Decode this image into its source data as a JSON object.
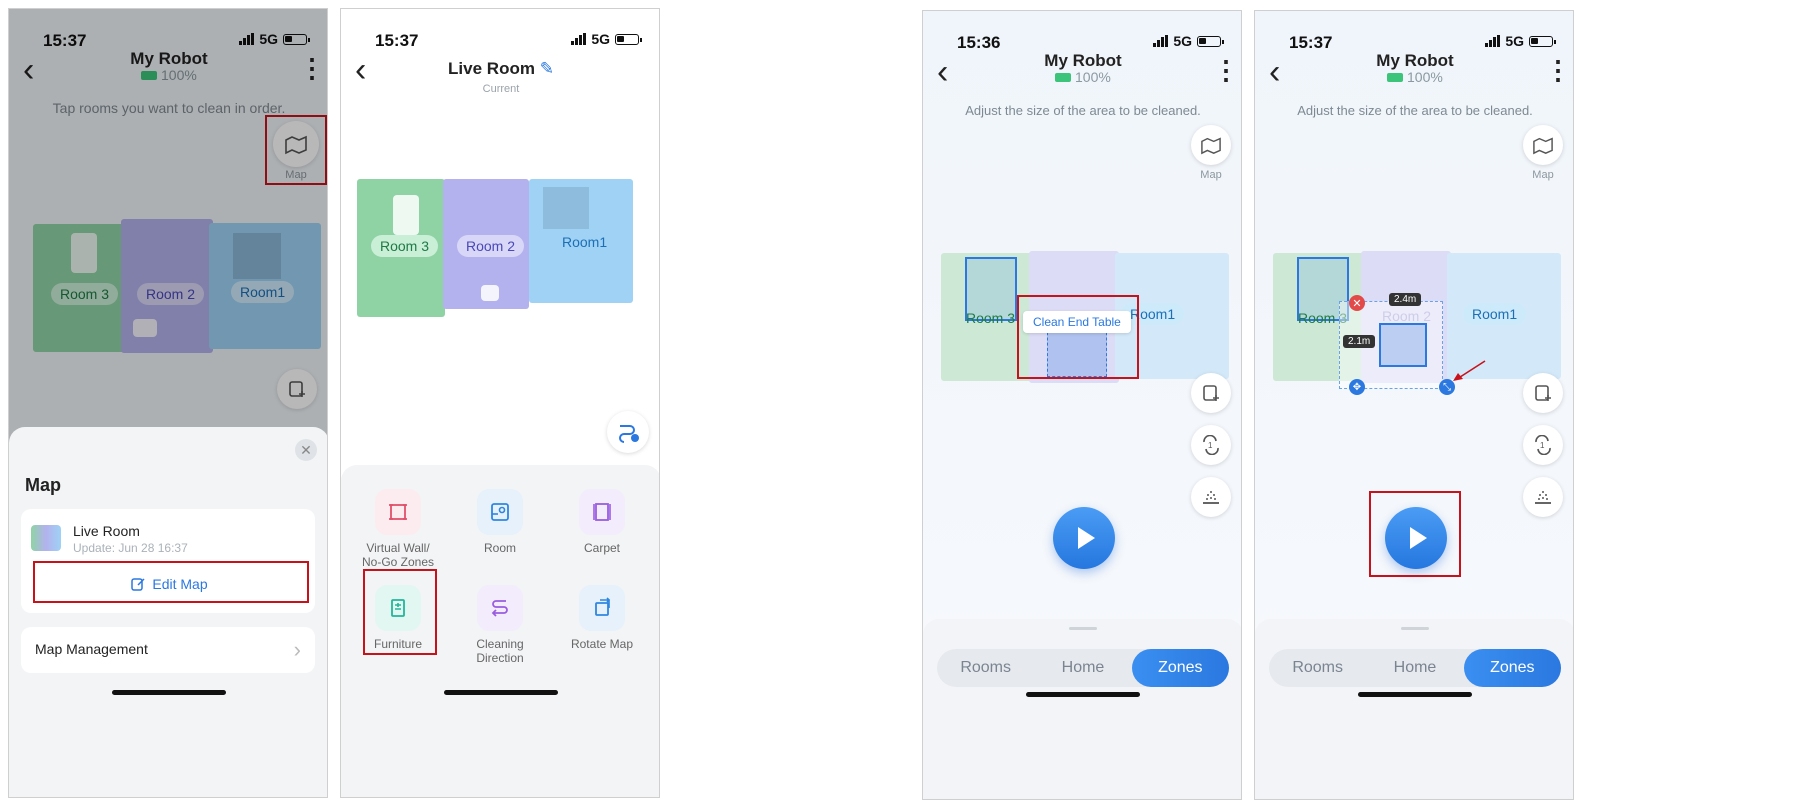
{
  "screen1": {
    "time": "15:37",
    "network": "5G",
    "title": "My Robot",
    "battery": "100%",
    "hint": "Tap rooms you want to clean in order.",
    "map_btn_label": "Map",
    "rooms": [
      "Room 3",
      "Room 2",
      "Room1"
    ],
    "sheet": {
      "title": "Map",
      "map_name": "Live Room",
      "map_update": "Update: Jun 28 16:37",
      "edit_label": "Edit Map",
      "management_label": "Map Management"
    }
  },
  "screen2": {
    "time": "15:37",
    "network": "5G",
    "title": "Live Room",
    "subtitle": "Current",
    "rooms": [
      "Room 3",
      "Room 2",
      "Room1"
    ],
    "tools": [
      {
        "label": "Virtual Wall/\nNo-Go Zones",
        "icon": "virtual-wall-icon",
        "color": "#e0506a"
      },
      {
        "label": "Room",
        "icon": "room-icon",
        "color": "#2f86e0"
      },
      {
        "label": "Carpet",
        "icon": "carpet-icon",
        "color": "#9a5de0"
      },
      {
        "label": "Furniture",
        "icon": "furniture-icon",
        "color": "#22b59a"
      },
      {
        "label": "Cleaning\nDirection",
        "icon": "cleaning-direction-icon",
        "color": "#9a5de0"
      },
      {
        "label": "Rotate Map",
        "icon": "rotate-map-icon",
        "color": "#2f86e0"
      }
    ]
  },
  "screen3": {
    "time": "15:36",
    "network": "5G",
    "title": "My Robot",
    "battery": "100%",
    "hint": "Adjust the size of the area to be cleaned.",
    "map_btn_label": "Map",
    "rooms": [
      "Room 3",
      "Room 2",
      "Room1"
    ],
    "tooltip": "Clean End Table",
    "tabs": [
      "Rooms",
      "Home",
      "Zones"
    ],
    "active_tab": "Zones"
  },
  "screen4": {
    "time": "15:37",
    "network": "5G",
    "title": "My Robot",
    "battery": "100%",
    "hint": "Adjust the size of the area to be cleaned.",
    "map_btn_label": "Map",
    "rooms": [
      "Room 3",
      "Room 2",
      "Room1"
    ],
    "dim_w": "2.4m",
    "dim_h": "2.1m",
    "tabs": [
      "Rooms",
      "Home",
      "Zones"
    ],
    "active_tab": "Zones"
  },
  "colors": {
    "accent": "#2a78e0",
    "highlight_box": "#c8121b",
    "room3": "#8fd3a5",
    "room2": "#b3b2ee",
    "room1": "#9fd2f5"
  }
}
